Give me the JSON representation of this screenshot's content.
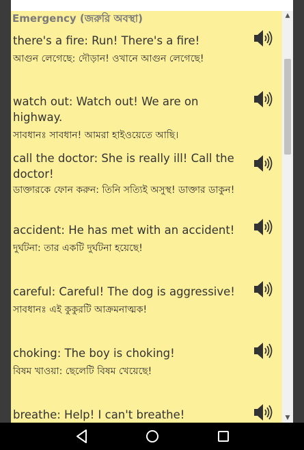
{
  "header": {
    "title": "Emergency (জরুরি অবস্থা)"
  },
  "phrases": [
    {
      "en": "there's a fire: Run! There's a fire!",
      "bn": "আগুন লেগেছে: দৌড়ান! ওখানে আগুন লেগেছে!"
    },
    {
      "en": "watch out: Watch out! We are on highway.",
      "bn": "সাবধানঃ সাবধান! আমরা হাইওয়েতে আছি।"
    },
    {
      "en": "call the doctor: She is really ill! Call the doctor!",
      "bn": "ডাক্তারকে ফোন করুন: তিনি সত্যিই অসুস্থ! ডাক্তার ডাকুন!"
    },
    {
      "en": "accident: He has met with an accident!",
      "bn": "দুর্ঘটনা: তার একটি দুর্ঘটনা হয়েছে!"
    },
    {
      "en": "careful: Careful! The dog is aggressive!",
      "bn": "সাবধানঃ এই কুকুরটি আক্রমনাত্মক!"
    },
    {
      "en": "choking: The boy is choking!",
      "bn": "বিষম খাওয়া: ছেলেটি বিষম খেয়েছে!"
    },
    {
      "en": "breathe: Help! I can't breathe!",
      "bn": ""
    }
  ],
  "icons": {
    "speaker": "speaker-icon",
    "back": "back-triangle-icon",
    "home": "home-circle-icon",
    "recents": "recents-square-icon"
  },
  "colors": {
    "background": "#fdf09a",
    "text": "#333333",
    "header": "#7a7a7a",
    "navbar": "#000000"
  }
}
